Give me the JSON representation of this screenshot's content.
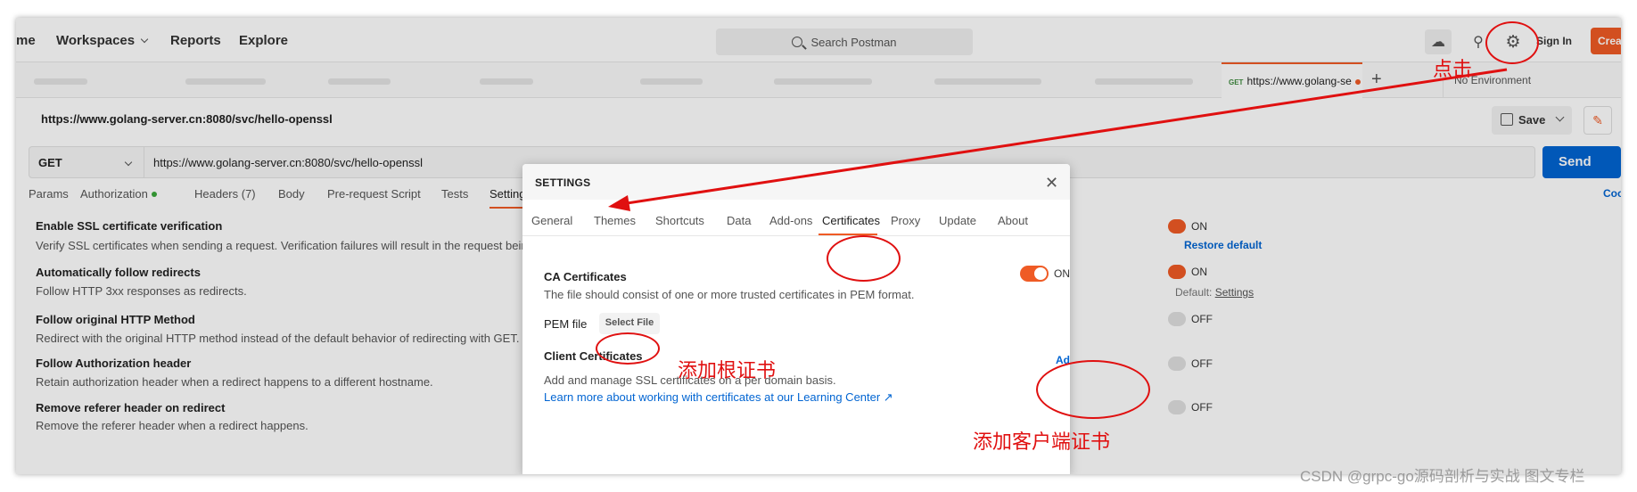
{
  "header": {
    "home_fragment": "me",
    "workspaces": "Workspaces",
    "reports": "Reports",
    "explore": "Explore",
    "search_placeholder": "Search Postman",
    "sign_in": "Sign In",
    "create": "Crea"
  },
  "tabs": {
    "active_method": "GET",
    "active_label": "https://www.golang-se",
    "environment": "No Environment"
  },
  "request": {
    "name": "https://www.golang-server.cn:8080/svc/hello-openssl",
    "save_label": "Save",
    "method": "GET",
    "url": "https://www.golang-server.cn:8080/svc/hello-openssl",
    "send_label": "Send",
    "tabs": [
      "Params",
      "Authorization",
      "Headers (7)",
      "Body",
      "Pre-request Script",
      "Tests",
      "Settings"
    ],
    "cookies": "Coo"
  },
  "settings_list": [
    {
      "title": "Enable SSL certificate verification",
      "desc": "Verify SSL certificates when sending a request. Verification failures will result in the request being aborted.",
      "state": "ON"
    },
    {
      "title": "Automatically follow redirects",
      "desc": "Follow HTTP 3xx responses as redirects.",
      "state": "ON"
    },
    {
      "title": "Follow original HTTP Method",
      "desc": "Redirect with the original HTTP method instead of the default behavior of redirecting with GET.",
      "state": "OFF"
    },
    {
      "title": "Follow Authorization header",
      "desc": "Retain authorization header when a redirect happens to a different hostname.",
      "state": "OFF"
    },
    {
      "title": "Remove referer header on redirect",
      "desc": "Remove the referer header when a redirect happens.",
      "state": "OFF"
    }
  ],
  "restore_default": "Restore default",
  "default_prefix": "Default: ",
  "default_link": "Settings",
  "modal": {
    "title": "SETTINGS",
    "tabs": [
      "General",
      "Themes",
      "Shortcuts",
      "Data",
      "Add-ons",
      "Certificates",
      "Proxy",
      "Update",
      "About"
    ],
    "ca_title": "CA Certificates",
    "ca_desc": "The file should consist of one or more trusted certificates in PEM format.",
    "pem_label": "PEM file",
    "select_file": "Select File",
    "ca_toggle": "ON",
    "client_title": "Client Certificates",
    "client_desc": "Add and manage SSL certificates on a per domain basis.",
    "learn_more": "Learn more about working with certificates at our Learning Center ↗",
    "add_certificate": "Add Certificate"
  },
  "annotations": {
    "click": "点击",
    "add_root": "添加根证书",
    "add_client": "添加客户端证书"
  },
  "watermark": "CSDN @grpc-go源码剖析与实战 图文专栏",
  "colors": {
    "accent": "#ef5b25",
    "link": "#0265d2",
    "annotation": "#e01010"
  }
}
